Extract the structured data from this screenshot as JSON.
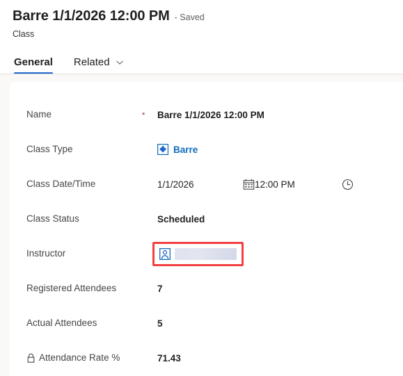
{
  "header": {
    "record_title": "Barre 1/1/2026 12:00 PM",
    "save_state": "- Saved",
    "entity_name": "Class"
  },
  "tabs": [
    {
      "label": "General",
      "active": true,
      "has_chevron": false
    },
    {
      "label": "Related",
      "active": false,
      "has_chevron": true,
      "chevron_icon": "chevron-down-icon"
    }
  ],
  "form": {
    "fields": [
      {
        "label": "Name",
        "required": true,
        "required_mark": "*",
        "type": "text",
        "value": "Barre 1/1/2026 12:00 PM",
        "bold": true,
        "locked": false
      },
      {
        "label": "Class Type",
        "required": false,
        "type": "lookup",
        "value": "Barre",
        "icon": "entity-record-icon",
        "locked": false
      },
      {
        "label": "Class Date/Time",
        "required": false,
        "type": "datetime",
        "date_value": "1/1/2026",
        "date_icon": "calendar-icon",
        "time_value": "12:00 PM",
        "time_icon": "clock-icon",
        "locked": false
      },
      {
        "label": "Class Status",
        "required": false,
        "type": "text",
        "value": "Scheduled",
        "bold": true,
        "locked": false
      },
      {
        "label": "Instructor",
        "required": false,
        "type": "lookup-loading",
        "value": "",
        "icon": "contact-person-icon",
        "highlighted": true,
        "locked": false
      },
      {
        "label": "Registered Attendees",
        "required": false,
        "type": "number",
        "value": "7",
        "bold": true,
        "locked": false
      },
      {
        "label": "Actual Attendees",
        "required": false,
        "type": "number",
        "value": "5",
        "bold": true,
        "locked": false
      },
      {
        "label": "Attendance Rate %",
        "required": false,
        "type": "number",
        "value": "71.43",
        "bold": true,
        "locked": true,
        "lock_icon": "lock-icon"
      }
    ]
  },
  "colors": {
    "accent_blue": "#2266cc",
    "link_blue": "#0f6cbd",
    "required_red": "#a4262c",
    "highlight_red": "#f23f42",
    "canvas_grey": "#faf9f8",
    "label_grey": "#484644",
    "text_dark": "#201f1e"
  }
}
